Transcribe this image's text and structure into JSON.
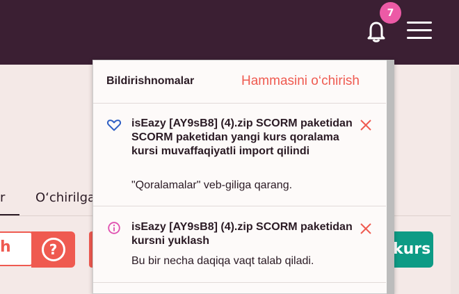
{
  "header": {
    "notifications_count": "7"
  },
  "tabs": [
    {
      "label": "r",
      "active": true
    },
    {
      "label": "O‘chirilgan"
    }
  ],
  "toolbar": {
    "search_fragment": "h",
    "help_icon_glyph": "?",
    "green_button_fragment": "kurs"
  },
  "notifications_panel": {
    "title": "Bildirishnomalar",
    "clear_all": "Hammasini o‘chirish",
    "items": [
      {
        "icon": "heart-icon",
        "title": "isEazy [AY9sB8] (4).zip SCORM paketidan SCORM paketidan yangi kurs qoralama kursi muvaffaqiyatli import qilindi",
        "body": "\"Qoralamalar\" veb-giliga qarang."
      },
      {
        "icon": "info-icon",
        "title": "isEazy [AY9sB8] (4).zip SCORM paketidan kursni yuklash",
        "body": "Bu bir necha daqiqa vaqt talab qiladi."
      }
    ]
  },
  "colors": {
    "header_bg": "#3b1f33",
    "badge": "#ec5aa6",
    "accent_red": "#ef5a50",
    "accent_green": "#0d9b85",
    "heart_blue": "#2f5fc4",
    "info_pink": "#e04fb0"
  }
}
